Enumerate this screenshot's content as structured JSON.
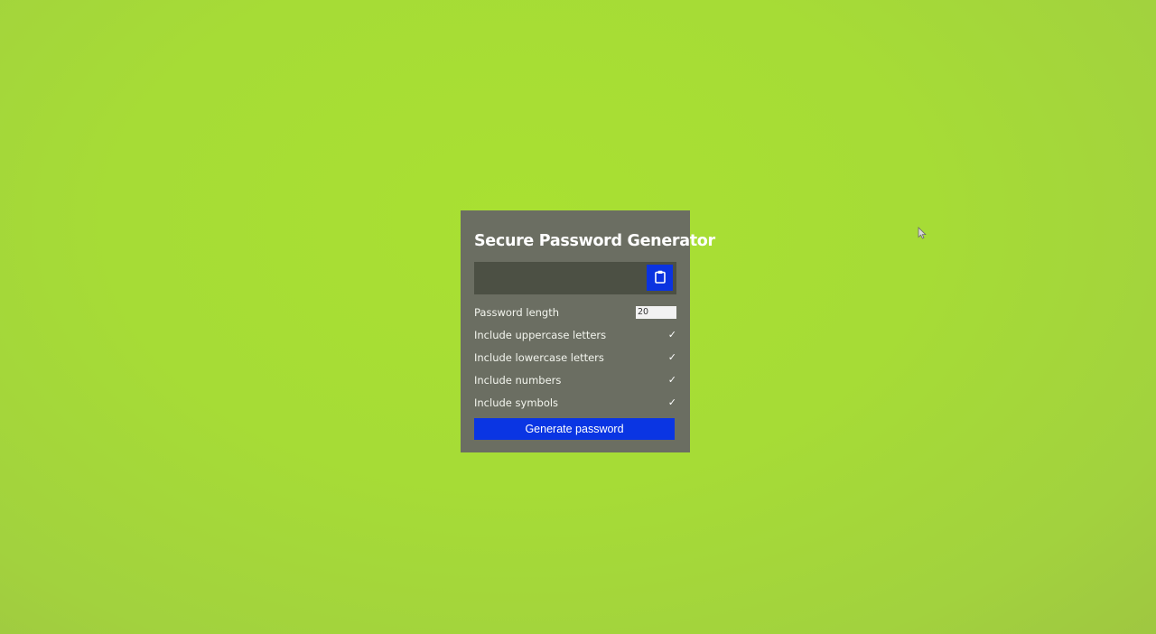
{
  "app": {
    "title": "Secure Password Generator"
  },
  "result": {
    "value": "",
    "copy_button_icon": "clipboard-icon"
  },
  "settings": {
    "length_label": "Password length",
    "length_value": "20",
    "options": [
      {
        "label": "Include uppercase letters",
        "checked": true,
        "check_glyph": "✓"
      },
      {
        "label": "Include lowercase letters",
        "checked": true,
        "check_glyph": "✓"
      },
      {
        "label": "Include numbers",
        "checked": true,
        "check_glyph": "✓"
      },
      {
        "label": "Include symbols",
        "checked": true,
        "check_glyph": "✓"
      }
    ]
  },
  "actions": {
    "generate_label": "Generate password"
  },
  "colors": {
    "background": "#a6dc36",
    "card": "#6b6e62",
    "result_field": "#4c5044",
    "accent_blue": "#0a35e3"
  }
}
